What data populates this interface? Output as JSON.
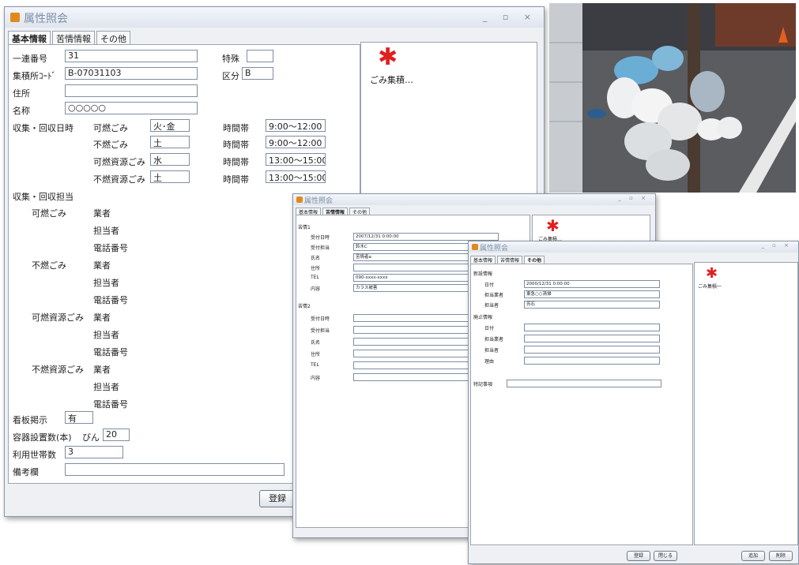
{
  "window_controls": "_ ▫ ×",
  "win1": {
    "title": "属性照会",
    "tabs": [
      "基本情報",
      "苦情情報",
      "その他"
    ],
    "fields": {
      "serial_label": "一連番号",
      "serial_value": "31",
      "special_label": "特殊",
      "special_value": "",
      "code_label": "集積所ｺｰﾄﾞ",
      "code_value": "B-07031103",
      "class_label": "区分",
      "class_value": "B",
      "address_label": "住所",
      "address_value": "",
      "name_label": "名称",
      "name_value": "○○○○○"
    },
    "schedule_label": "収集・回収日時",
    "schedule": [
      {
        "type": "可燃ごみ",
        "day": "火･金",
        "time_label": "時間帯",
        "time": "9:00～12:00"
      },
      {
        "type": "不燃ごみ",
        "day": "土",
        "time_label": "時間帯",
        "time": "9:00～12:00"
      },
      {
        "type": "可燃資源ごみ",
        "day": "水",
        "time_label": "時間帯",
        "time": "13:00～15:00"
      },
      {
        "type": "不燃資源ごみ",
        "day": "土",
        "time_label": "時間帯",
        "time": "13:00～15:00"
      }
    ],
    "staff_label": "収集・回収担当",
    "staff_groups": [
      {
        "type": "可燃ごみ",
        "rows": [
          "業者",
          "担当者",
          "電話番号"
        ]
      },
      {
        "type": "不燃ごみ",
        "rows": [
          "業者",
          "担当者",
          "電話番号"
        ]
      },
      {
        "type": "可燃資源ごみ",
        "rows": [
          "業者",
          "担当者",
          "電話番号"
        ]
      },
      {
        "type": "不燃資源ごみ",
        "rows": [
          "業者",
          "担当者",
          "電話番号"
        ]
      }
    ],
    "sign_label": "看板掲示",
    "sign_value": "有",
    "container_label": "容器設置数(本)",
    "container_sub": "びん",
    "container_value": "20",
    "households_label": "利用世帯数",
    "households_value": "3",
    "remarks_label": "備考欄",
    "remarks_value": "",
    "map_caption": "ごみ集積…",
    "register_button": "登録"
  },
  "win2": {
    "title": "属性照会",
    "tabs": [
      "基本情報",
      "苦情情報",
      "その他"
    ],
    "group1": "苦情1",
    "group2": "苦情2",
    "g1_rows": [
      {
        "label": "受付日時",
        "value": "2007/12/31 0:00:00"
      },
      {
        "label": "受付担当",
        "value": "鈴木C"
      },
      {
        "label": "氏名",
        "value": "苦情者a"
      },
      {
        "label": "住所",
        "value": ""
      },
      {
        "label": "TEL",
        "value": "090-xxxx-xxxx"
      },
      {
        "label": "内容",
        "value": "カラス被害"
      }
    ],
    "g2_rows": [
      {
        "label": "受付日時",
        "value": ""
      },
      {
        "label": "受付担当",
        "value": ""
      },
      {
        "label": "氏名",
        "value": ""
      },
      {
        "label": "住所",
        "value": ""
      },
      {
        "label": "TEL",
        "value": ""
      },
      {
        "label": "内容",
        "value": ""
      }
    ],
    "map_caption": "ごみ集積…"
  },
  "win3": {
    "title": "属性照会",
    "tabs": [
      "基本情報",
      "苦情情報",
      "その他"
    ],
    "group1": "新設情報",
    "g1_rows": [
      {
        "label": "日付",
        "value": "2000/12/31 0:00:00"
      },
      {
        "label": "担当業者",
        "value": "東急○○清掃"
      },
      {
        "label": "担当者",
        "value": "芳石"
      }
    ],
    "group2": "廃止情報",
    "g2_rows": [
      {
        "label": "日付",
        "value": ""
      },
      {
        "label": "担当業者",
        "value": ""
      },
      {
        "label": "担当者",
        "value": ""
      },
      {
        "label": "理由",
        "value": ""
      }
    ],
    "notes_label": "特記事項",
    "notes_value": "",
    "map_caption": "ごみ集積一",
    "buttons": [
      "登録",
      "閉じる",
      "追加",
      "削除"
    ]
  }
}
